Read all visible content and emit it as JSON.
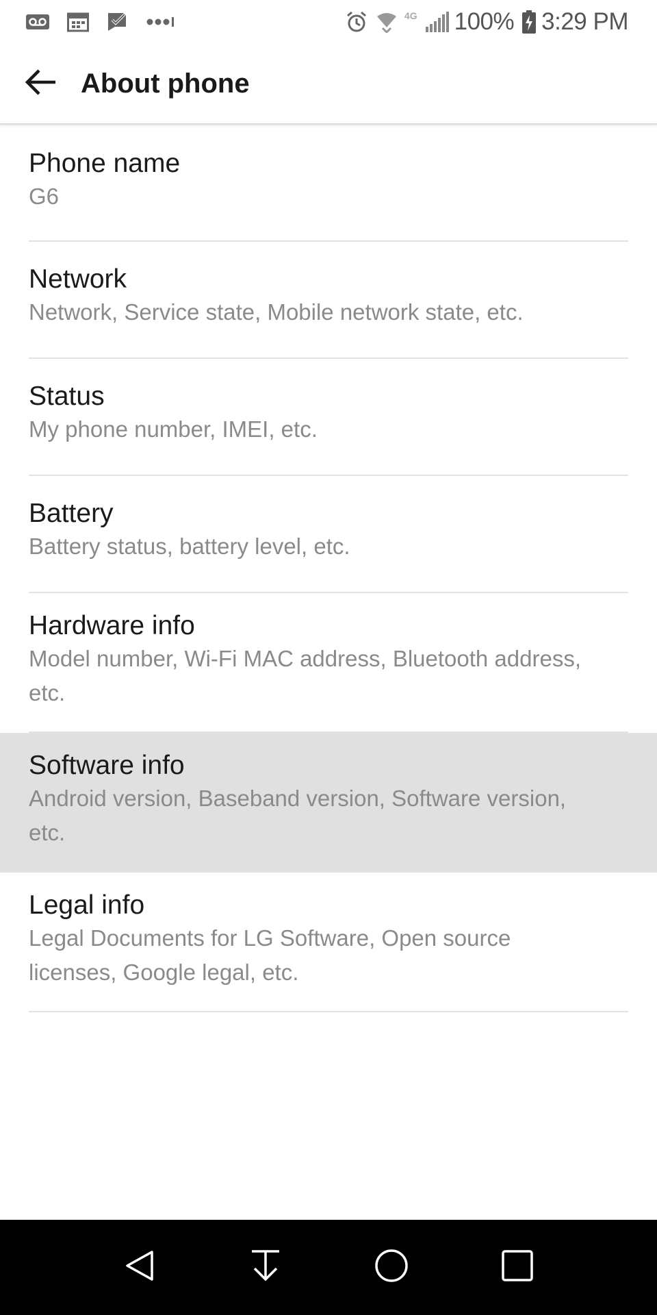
{
  "status_bar": {
    "battery_percent": "100%",
    "time": "3:29 PM",
    "network_type": "4G",
    "left_icons": [
      "voicemail-icon",
      "calendar-icon",
      "check-message-icon",
      "more-dots-icon"
    ],
    "right_icons": [
      "alarm-icon",
      "wifi-icon",
      "signal-icon",
      "battery-charging-icon"
    ]
  },
  "app_bar": {
    "title": "About phone"
  },
  "items": [
    {
      "title": "Phone name",
      "subtitle": "G6"
    },
    {
      "title": "Network",
      "subtitle": "Network, Service state, Mobile network state, etc."
    },
    {
      "title": "Status",
      "subtitle": "My phone number, IMEI, etc."
    },
    {
      "title": "Battery",
      "subtitle": "Battery status, battery level, etc."
    },
    {
      "title": "Hardware info",
      "subtitle": "Model number, Wi-Fi MAC address, Bluetooth address, etc."
    },
    {
      "title": "Software info",
      "subtitle": "Android version, Baseband version, Software version, etc.",
      "pressed": true
    },
    {
      "title": "Legal info",
      "subtitle": "Legal Documents for LG Software, Open source licenses, Google legal, etc."
    }
  ],
  "nav_bar": {
    "buttons": [
      "back-icon",
      "notification-pull-icon",
      "home-icon",
      "recents-icon"
    ]
  },
  "colors": {
    "pressed_row": "#e0e0e0",
    "divider": "#e3e3e3",
    "subtitle_text": "#8a8a8a",
    "nav_background": "#000000"
  }
}
